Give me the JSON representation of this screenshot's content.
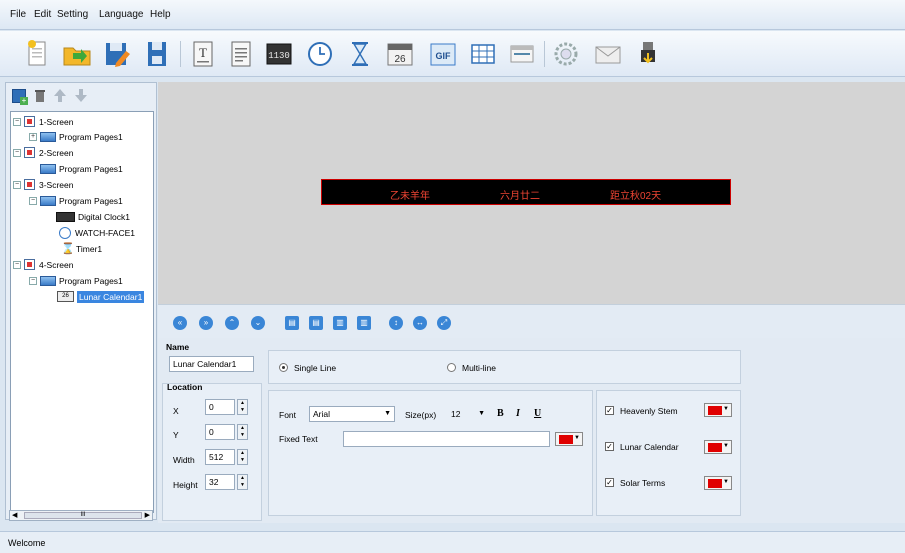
{
  "menu": [
    "File",
    "Edit",
    "Setting",
    "Language",
    "Help"
  ],
  "toolbar": {
    "icons": [
      "new-file-icon",
      "open-folder-icon",
      "edit-icon",
      "save-icon",
      "text-icon",
      "document-icon",
      "digital-clock-icon",
      "analog-clock-icon",
      "timer-icon",
      "calendar-icon",
      "gif-icon",
      "table-icon",
      "window-icon",
      "settings-gear-icon",
      "send-mail-icon",
      "usb-export-icon"
    ],
    "digital_clock_text": "1130",
    "calendar_day": "26",
    "gif_text": "GIF"
  },
  "tree": {
    "add_icon": "add-icon",
    "delete_icon": "trash-icon",
    "up_icon": "arrow-up-icon",
    "down_icon": "arrow-down-icon",
    "s1": "1-Screen",
    "s1p": "Program Pages1",
    "s2": "2-Screen",
    "s2p": "Program Pages1",
    "s3": "3-Screen",
    "s3p": "Program Pages1",
    "s3c1": "Digital Clock1",
    "s3c2": "WATCH-FACE1",
    "s3c3": "Timer1",
    "s4": "4-Screen",
    "s4p": "Program Pages1",
    "s4c1": "Lunar Calendar1",
    "scroll_thumb": "III"
  },
  "led": {
    "year": "乙未羊年",
    "date": "六月廿二",
    "solar": "距立秋02天"
  },
  "align_icons": [
    "first-icon",
    "last-icon",
    "top-icon",
    "bottom-icon",
    "align-left-icon",
    "align-right-icon",
    "align-top-icon",
    "align-bottom-icon",
    "height-icon",
    "width-icon",
    "fullscreen-icon"
  ],
  "props": {
    "name_label": "Name",
    "name_value": "Lunar Calendar1",
    "location_label": "Location",
    "x_label": "X",
    "x_value": "0",
    "y_label": "Y",
    "y_value": "0",
    "width_label": "Width",
    "width_value": "512",
    "height_label": "Height",
    "height_value": "32",
    "single_line": "Single Line",
    "multi_line": "Multi-line",
    "font_label": "Font",
    "font_value": "Arial",
    "size_label": "Size(px)",
    "size_value": "12",
    "bold": "B",
    "italic": "I",
    "underline": "U",
    "fixed_text_label": "Fixed Text",
    "fixed_text_value": "",
    "heavenly_stem": "Heavenly Stem",
    "lunar_calendar": "Lunar Calendar",
    "solar_terms": "Solar Terms",
    "color": "#e00000"
  },
  "status": "Welcome"
}
